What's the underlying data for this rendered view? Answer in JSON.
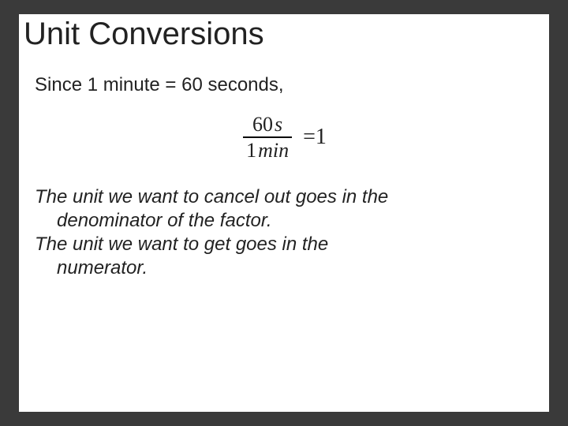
{
  "title": "Unit Conversions",
  "line1": "Since 1 minute = 60 seconds,",
  "equation": {
    "num_value": "60",
    "num_unit": "s",
    "den_value": "1",
    "den_unit": "min",
    "equals": "=",
    "rhs": "1"
  },
  "para1_line1": "The unit we want to cancel out goes in the",
  "para1_line2": "denominator of the factor.",
  "para2_line1": "The unit we want to get goes in the",
  "para2_line2": "numerator."
}
